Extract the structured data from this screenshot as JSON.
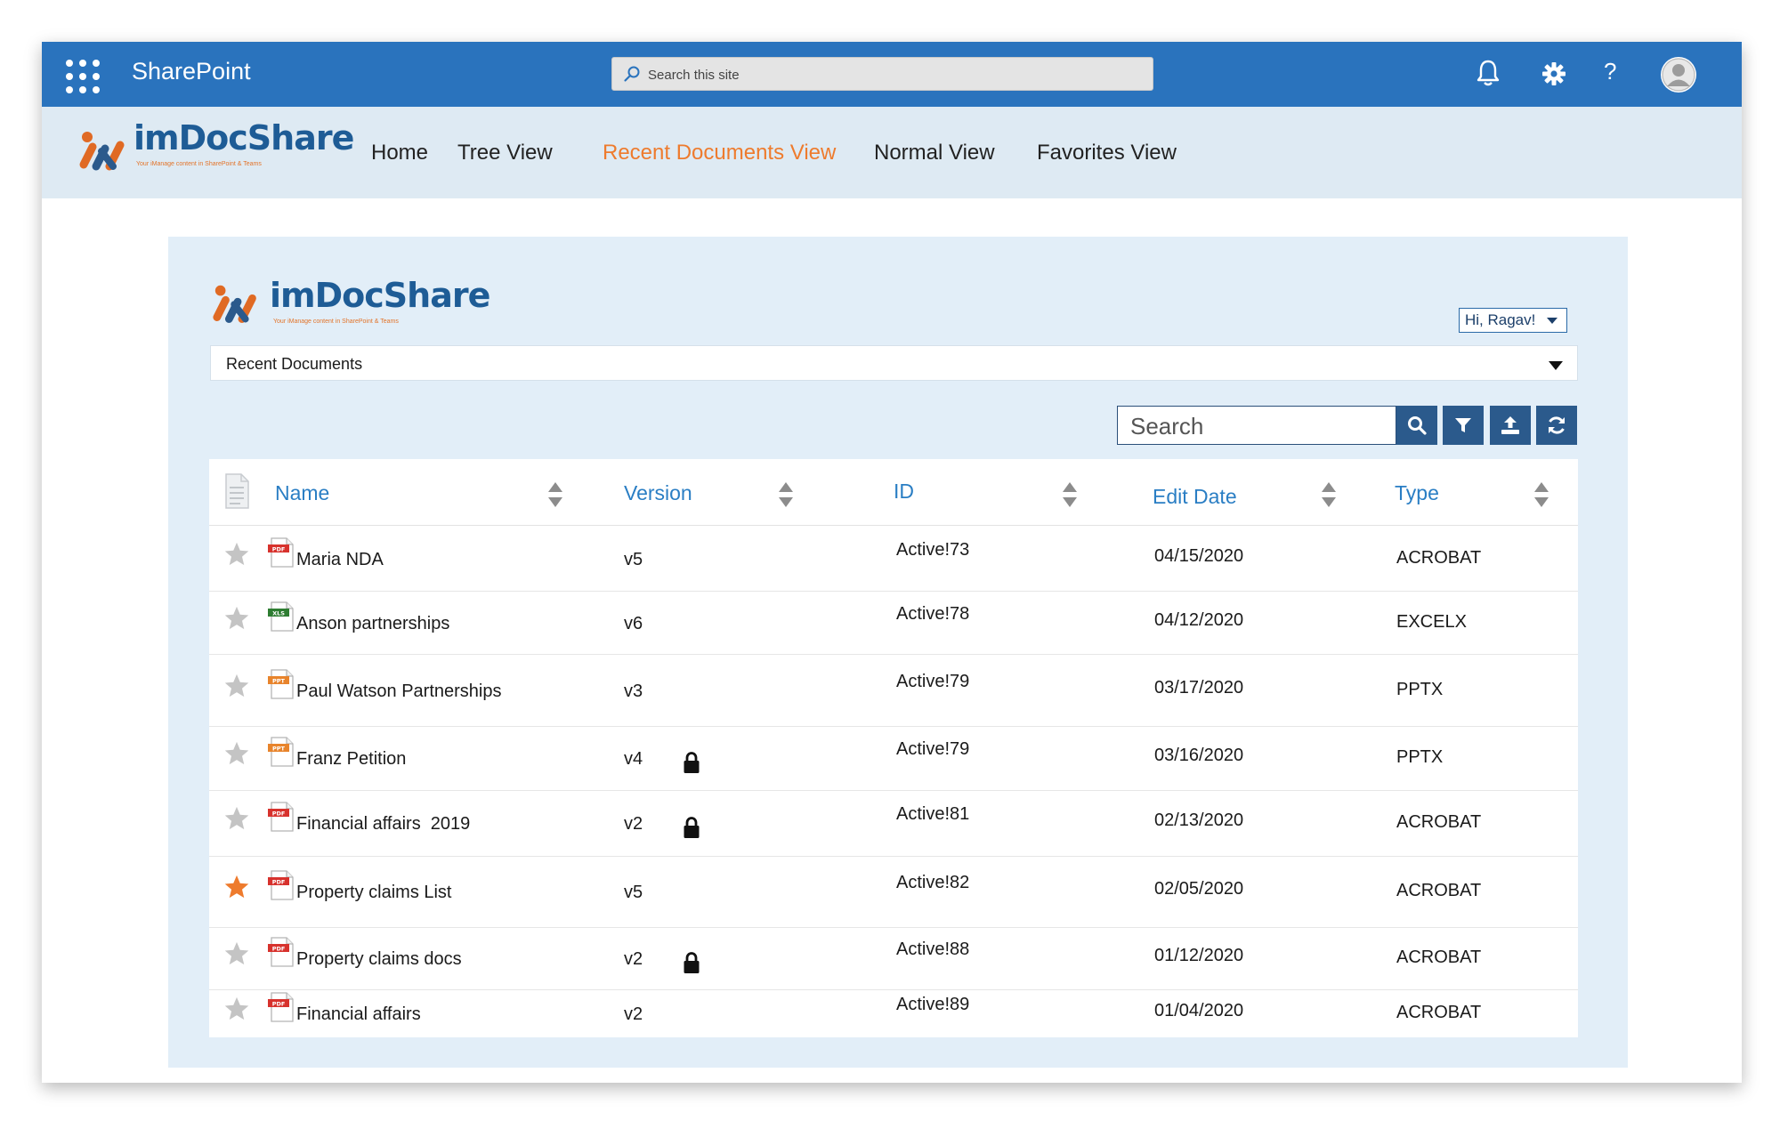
{
  "topbar": {
    "brand": "SharePoint",
    "search_placeholder": "Search this site",
    "icons": [
      "waffle-icon",
      "search-icon",
      "bell-icon",
      "gear-icon",
      "help-icon",
      "user-avatar-icon"
    ],
    "help_label": "?",
    "color": "#2a73bd"
  },
  "logo": {
    "name": "imDocShare",
    "tagline": "Your iManage content in SharePoint & Teams"
  },
  "nav": {
    "items": [
      {
        "label": "Home"
      },
      {
        "label": "Tree View"
      },
      {
        "label": "Recent Documents View",
        "active": true
      },
      {
        "label": "Normal View"
      },
      {
        "label": "Favorites View"
      }
    ],
    "active_color": "#ee7b2d"
  },
  "panel": {
    "greeting": "Hi, Ragav!",
    "view_select": "Recent Documents",
    "search_placeholder": "Search",
    "buttons": [
      "search-icon",
      "filter-icon",
      "upload-icon",
      "refresh-icon"
    ]
  },
  "table": {
    "columns": [
      "Name",
      "Version",
      "ID",
      "Edit Date",
      "Type"
    ],
    "rows": [
      {
        "name": "Maria NDA",
        "version": "v5",
        "id": "Active!73",
        "date": "04/15/2020",
        "type": "ACROBAT",
        "icon": "PDF",
        "locked": false,
        "favorite": false
      },
      {
        "name": "Anson partnerships",
        "version": "v6",
        "id": "Active!78",
        "date": "04/12/2020",
        "type": "EXCELX",
        "icon": "XLS",
        "locked": false,
        "favorite": false
      },
      {
        "name": "Paul Watson Partnerships",
        "version": "v3",
        "id": "Active!79",
        "date": "03/17/2020",
        "type": "PPTX",
        "icon": "PPT",
        "locked": false,
        "favorite": false
      },
      {
        "name": "Franz Petition",
        "version": "v4",
        "id": "Active!79",
        "date": "03/16/2020",
        "type": "PPTX",
        "icon": "PPT",
        "locked": true,
        "favorite": false
      },
      {
        "name": "Financial affairs  2019",
        "version": "v2",
        "id": "Active!81",
        "date": "02/13/2020",
        "type": "ACROBAT",
        "icon": "PDF",
        "locked": true,
        "favorite": false
      },
      {
        "name": "Property claims List",
        "version": "v5",
        "id": "Active!82",
        "date": "02/05/2020",
        "type": "ACROBAT",
        "icon": "PDF",
        "locked": false,
        "favorite": true
      },
      {
        "name": "Property claims docs",
        "version": "v2",
        "id": "Active!88",
        "date": "01/12/2020",
        "type": "ACROBAT",
        "icon": "PDF",
        "locked": true,
        "favorite": false
      },
      {
        "name": "Financial affairs",
        "version": "v2",
        "id": "Active!89",
        "date": "01/04/2020",
        "type": "ACROBAT",
        "icon": "PDF",
        "locked": false,
        "favorite": false
      }
    ],
    "colors": {
      "header": "#2a7ec4",
      "pdf": "#d7322d",
      "xls": "#2e7d32",
      "ppt": "#e8842c",
      "favorite": "#ee7b2d",
      "star": "#c4c4c4"
    }
  }
}
